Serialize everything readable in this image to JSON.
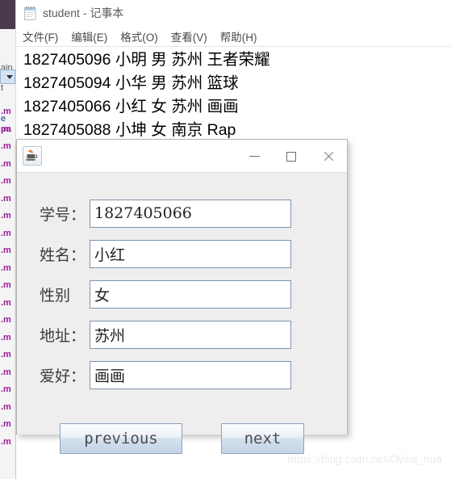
{
  "ide_backdrop": {
    "title_strip_color": "#4b3a4e",
    "fragments": [
      {
        "text": "ain",
        "style": "plain"
      },
      {
        "text": "t",
        "style": "plain"
      },
      {
        "text": "e",
        "style": "blue"
      },
      {
        "text": "pa",
        "style": "accent"
      }
    ],
    "file_items": [
      ".m",
      ".m",
      ".m",
      ".m",
      ".m",
      ".m",
      ".m",
      ".m",
      ".m",
      ".m",
      ".m",
      ".m",
      ".m",
      ".m",
      ".m",
      ".m",
      ".m",
      ".m",
      ".m",
      ".m"
    ],
    "combo_icon": "chevron-down-icon"
  },
  "notepad": {
    "icon": "notepad-icon",
    "title": "student - 记事本",
    "menus": [
      {
        "label": "文件(F)"
      },
      {
        "label": "编辑(E)"
      },
      {
        "label": "格式(O)"
      },
      {
        "label": "查看(V)"
      },
      {
        "label": "帮助(H)"
      }
    ],
    "lines": [
      "1827405096 小明 男 苏州 王者荣耀",
      "1827405094 小华 男 苏州 篮球",
      "1827405066 小红 女 苏州 画画",
      "1827405088 小坤 女 南京 Rap"
    ]
  },
  "dialog": {
    "app_icon": "java-coffee-cup-icon",
    "title": "",
    "window_controls": [
      {
        "name": "minimize",
        "glyph": "minimize-icon"
      },
      {
        "name": "maximize",
        "glyph": "maximize-icon"
      },
      {
        "name": "close",
        "glyph": "close-icon"
      }
    ],
    "fields": [
      {
        "label": "学号：",
        "value": "1827405066"
      },
      {
        "label": "姓名：",
        "value": "小红"
      },
      {
        "label": "性别",
        "value": "女"
      },
      {
        "label": "地址：",
        "value": "苏州"
      },
      {
        "label": "爱好：",
        "value": "画画"
      }
    ],
    "buttons": {
      "previous": "previous",
      "next": "next"
    },
    "field_border_color": "#7c93ad",
    "background_color": "#efeeee"
  },
  "watermark": {
    "text": "https://blog.csdn.net/Ovilia_hua"
  }
}
